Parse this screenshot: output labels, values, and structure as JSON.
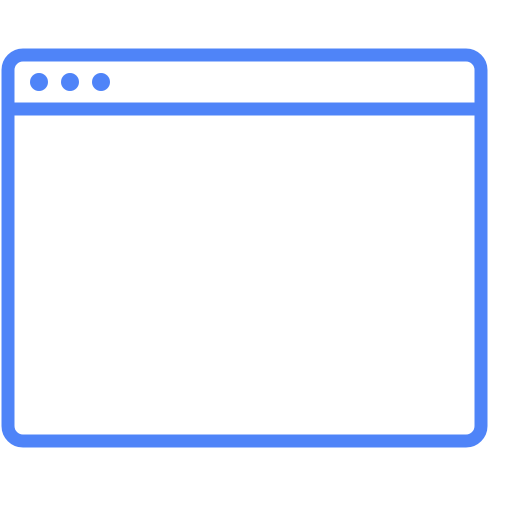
{
  "icon": {
    "name": "browser-window-icon",
    "color": "#4f84f8"
  }
}
